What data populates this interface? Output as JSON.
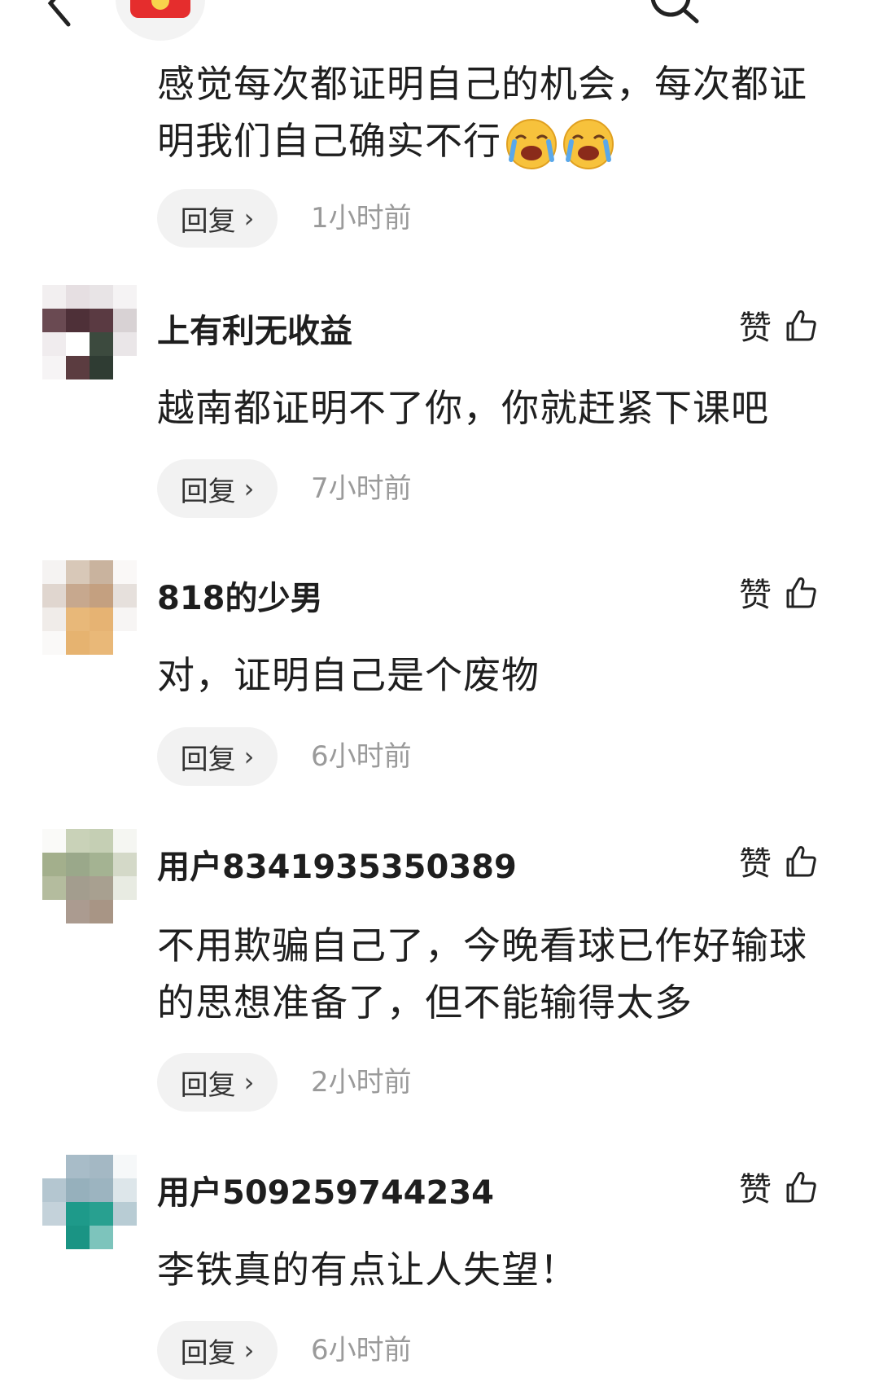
{
  "header": {
    "back_icon": "chevron-left-icon",
    "avatar_icon": "red-packet-icon",
    "search_icon": "search-icon"
  },
  "labels": {
    "reply": "回复",
    "like": "赞"
  },
  "colors": {
    "time_text": "#9a9a9a",
    "reply_bg": "#f2f2f2",
    "red_packet": "#e52d2d"
  },
  "comments": [
    {
      "username": "",
      "text": "感觉每次都证明自己的机会，每次都证明我们自己确实不行",
      "emoji": "loudly-crying-face-icon ×2",
      "time": "1小时前"
    },
    {
      "username": "上有利无收益",
      "text": "越南都证明不了你，你就赶紧下课吧",
      "time": "7小时前"
    },
    {
      "username": "818的少男",
      "text": "对，证明自己是个废物",
      "time": "6小时前"
    },
    {
      "username": "用户8341935350389",
      "text": "不用欺骗自己了，今晚看球已作好输球的思想准备了，但不能输得太多",
      "time": "2小时前"
    },
    {
      "username": "用户509259744234",
      "text": "李铁真的有点让人失望！",
      "time": "6小时前"
    }
  ]
}
